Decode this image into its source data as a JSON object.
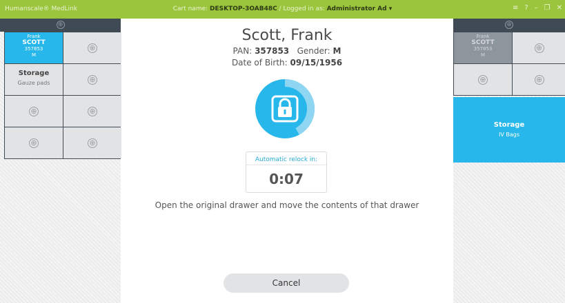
{
  "titlebar": {
    "app": "Humanscale® MedLink",
    "cart_label": "Cart name:",
    "cart_name": "DESKTOP-3OAB48C",
    "sep": "/",
    "logged_label": "Logged in as:",
    "user": "Administrator Ad",
    "caret": "▾",
    "menu_icon": "≡",
    "help_icon": "?",
    "minimize_icon": "–",
    "restore_icon": "❐",
    "close_icon": "✕"
  },
  "left_cabinet": {
    "patient": {
      "first": "Frank",
      "last": "SCOTT",
      "pan": "357853",
      "gender": "M"
    },
    "storage": {
      "title": "Storage",
      "subtitle": "Gauze pads"
    }
  },
  "right_cabinet": {
    "patient": {
      "first": "Frank",
      "last": "SCOTT",
      "pan": "357853",
      "gender": "M"
    },
    "storage": {
      "title": "Storage",
      "subtitle": "IV Bags"
    }
  },
  "main": {
    "name": "Scott, Frank",
    "pan_label": "PAN:",
    "pan": "357853",
    "gender_label": "Gender:",
    "gender": "M",
    "dob_label": "Date of Birth:",
    "dob": "09/15/1956",
    "relock_label": "Automatic relock in:",
    "relock_value": "0:07",
    "relock_progress": 0.42,
    "instruction": "Open the original drawer and move the contents of that drawer",
    "cancel": "Cancel"
  },
  "icons": {
    "add": "⊕",
    "lock": "lock-icon"
  },
  "colors": {
    "titlebar": "#9bc53d",
    "accent": "#27b7ea",
    "dark": "#3f4a55"
  }
}
